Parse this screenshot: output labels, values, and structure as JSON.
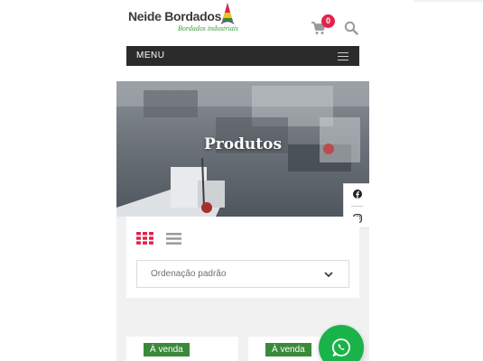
{
  "header": {
    "logo_title": "Neide Bordados",
    "logo_subtitle": "Bordados industriais",
    "cart_count": "0",
    "cart_icon": "cart-icon",
    "search_icon": "search-icon"
  },
  "menu": {
    "label": "MENU",
    "icon": "hamburger-icon"
  },
  "hero": {
    "title": "Produtos"
  },
  "social": {
    "items": [
      "facebook-icon",
      "instagram-icon"
    ]
  },
  "controls": {
    "view_grid_icon": "grid-view-icon",
    "view_list_icon": "list-view-icon",
    "sort_value": "Ordenação padrão"
  },
  "products": [
    {
      "badge": "À venda"
    },
    {
      "badge": "À venda"
    }
  ],
  "colors": {
    "accent_red": "#e3224a",
    "menu_bg": "#2b2b2b",
    "badge_green": "#3a8a3a",
    "whatsapp_green": "#19b34a",
    "panel_gray": "#f1f1f1"
  }
}
